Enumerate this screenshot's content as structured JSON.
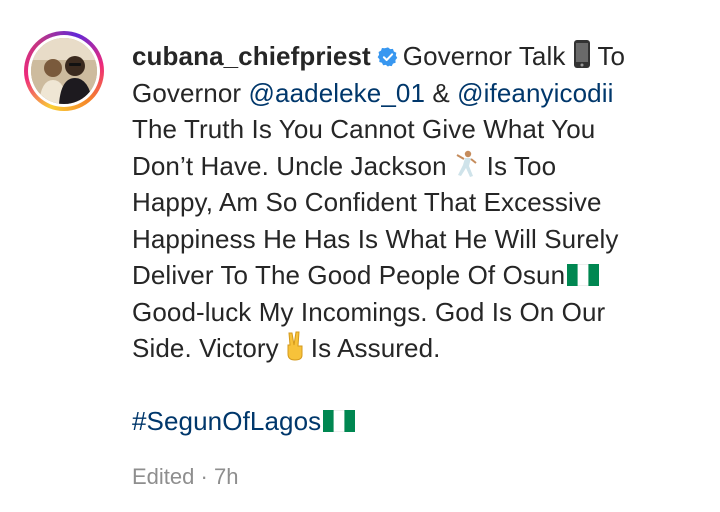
{
  "comment": {
    "username": "cubana_chiefpriest",
    "verified_icon": "verified-badge-icon",
    "lines": [
      {
        "a": "Governor Talk",
        "b": "To"
      },
      {
        "prefix": "Governor ",
        "mention1": "@aadeleke_01",
        "joiner": " & ",
        "mention2": "@ifeanyicodii"
      },
      {
        "text": "The Truth Is You Cannot Give What You"
      },
      {
        "a": "Don’t Have. Uncle Jackson",
        "b": "Is Too"
      },
      {
        "text": "Happy, Am So Confident That Excessive"
      },
      {
        "text": "Happiness He Has Is What He Will Surely"
      },
      {
        "text": "Deliver To The Good People Of Osun"
      },
      {
        "text": "Good-luck My Incomings. God Is On Our"
      },
      {
        "a": "Side. Victory",
        "b": "Is Assured."
      }
    ],
    "hashtag": "#SegunOfLagos",
    "edited": "Edited",
    "separator": "·",
    "time": "7h",
    "icons": [
      "phone-emoji-icon",
      "dancer-emoji-icon",
      "nigeria-flag-icon",
      "victory-hand-emoji-icon"
    ],
    "colors": {
      "link": "#00376b",
      "meta": "#8e8e8e",
      "verified": "#3897f0",
      "text": "#262626"
    }
  }
}
